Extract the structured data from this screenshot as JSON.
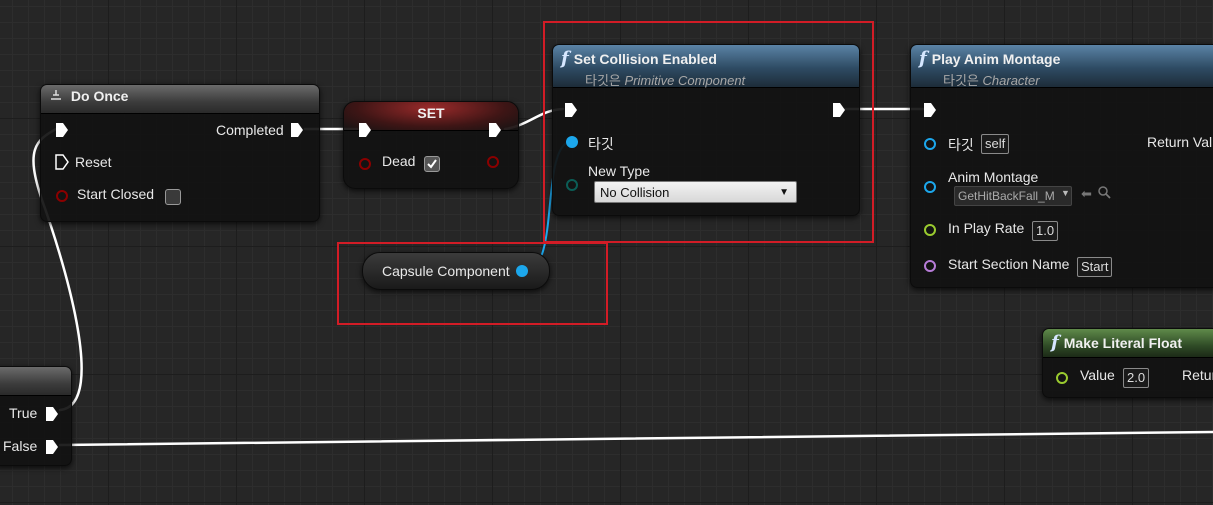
{
  "nodes": {
    "do_once": {
      "title": "Do Once",
      "completed": "Completed",
      "reset": "Reset",
      "start_closed": "Start Closed"
    },
    "set": {
      "title": "SET",
      "dead": "Dead"
    },
    "capsule": {
      "label": "Capsule Component"
    },
    "set_collision": {
      "title": "Set Collision Enabled",
      "subtitle_prefix": "타깃은",
      "subtitle_class": "Primitive Component",
      "target": "타깃",
      "new_type_label": "New Type",
      "new_type_value": "No Collision"
    },
    "play_montage": {
      "title": "Play Anim Montage",
      "subtitle_prefix": "타깃은",
      "subtitle_class": "Character",
      "target": "타깃",
      "target_value": "self",
      "return_value": "Return Val",
      "anim_montage": "Anim Montage",
      "anim_montage_value": "GetHitBackFall_M",
      "in_play_rate": "In Play Rate",
      "in_play_rate_value": "1.0",
      "start_section": "Start Section Name",
      "start_section_value": "Start"
    },
    "make_literal_float": {
      "title": "Make Literal Float",
      "value_label": "Value",
      "value": "2.0",
      "return": "Retur"
    },
    "branch": {
      "true_label": "True",
      "false_label": "False"
    }
  },
  "icons": {
    "function": "f",
    "do_once": "do-once-icon"
  },
  "colors": {
    "exec": "#ffffff",
    "object_pin": "#1ca7ec",
    "bool_pin": "#8b0000",
    "enum_pin": "#0b5d56",
    "float_pin": "#9acb2f",
    "name_pin": "#b77cd8",
    "highlight": "#d21c26"
  }
}
